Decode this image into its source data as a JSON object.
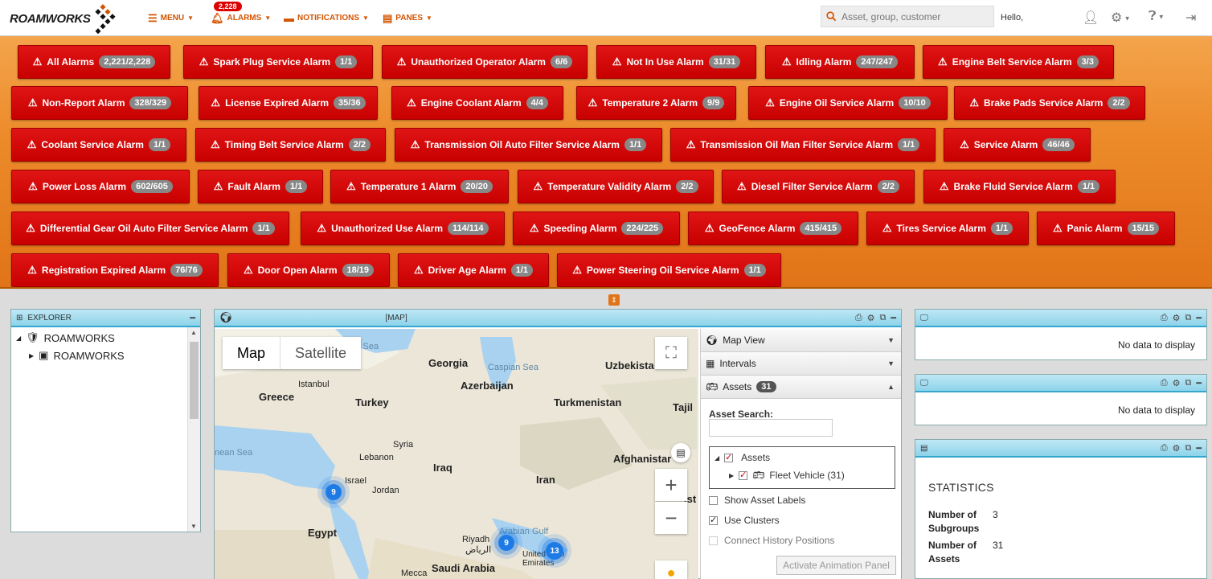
{
  "header": {
    "logo": "ROAMWORKS",
    "menu_label": "MENU",
    "alarms_label": "ALARMS",
    "alarms_count": "2,228",
    "notifications_label": "NOTIFICATIONS",
    "panes_label": "PANES",
    "search_placeholder": "Asset, group, customer",
    "hello": "Hello,"
  },
  "alarms": [
    {
      "label": "All Alarms",
      "count": "2,221/2,228"
    },
    {
      "label": "Spark Plug Service Alarm",
      "count": "1/1"
    },
    {
      "label": "Unauthorized Operator Alarm",
      "count": "6/6"
    },
    {
      "label": "Not In Use Alarm",
      "count": "31/31"
    },
    {
      "label": "Idling Alarm",
      "count": "247/247"
    },
    {
      "label": "Engine Belt Service Alarm",
      "count": "3/3"
    },
    {
      "label": "Non-Report Alarm",
      "count": "328/329"
    },
    {
      "label": "License Expired Alarm",
      "count": "35/36"
    },
    {
      "label": "Engine Coolant Alarm",
      "count": "4/4"
    },
    {
      "label": "Temperature 2 Alarm",
      "count": "9/9"
    },
    {
      "label": "Engine Oil Service Alarm",
      "count": "10/10"
    },
    {
      "label": "Brake Pads Service Alarm",
      "count": "2/2"
    },
    {
      "label": "Coolant Service Alarm",
      "count": "1/1"
    },
    {
      "label": "Timing Belt Service Alarm",
      "count": "2/2"
    },
    {
      "label": "Transmission Oil Auto Filter Service Alarm",
      "count": "1/1"
    },
    {
      "label": "Transmission Oil Man Filter Service Alarm",
      "count": "1/1"
    },
    {
      "label": "Service Alarm",
      "count": "46/46"
    },
    {
      "label": "Power Loss Alarm",
      "count": "602/605"
    },
    {
      "label": "Fault Alarm",
      "count": "1/1"
    },
    {
      "label": "Temperature 1 Alarm",
      "count": "20/20"
    },
    {
      "label": "Temperature Validity Alarm",
      "count": "2/2"
    },
    {
      "label": "Diesel Filter Service Alarm",
      "count": "2/2"
    },
    {
      "label": "Brake Fluid Service Alarm",
      "count": "1/1"
    },
    {
      "label": "Differential Gear Oil Auto Filter Service Alarm",
      "count": "1/1"
    },
    {
      "label": "Unauthorized Use Alarm",
      "count": "114/114"
    },
    {
      "label": "Speeding Alarm",
      "count": "224/225"
    },
    {
      "label": "GeoFence Alarm",
      "count": "415/415"
    },
    {
      "label": "Tires Service Alarm",
      "count": "1/1"
    },
    {
      "label": "Panic Alarm",
      "count": "15/15"
    },
    {
      "label": "Registration Expired Alarm",
      "count": "76/76"
    },
    {
      "label": "Door Open Alarm",
      "count": "18/19"
    },
    {
      "label": "Driver Age Alarm",
      "count": "1/1"
    },
    {
      "label": "Power Steering Oil Service Alarm",
      "count": "1/1"
    }
  ],
  "explorer": {
    "title": "EXPLORER",
    "tree": [
      {
        "label": "ROAMWORKS"
      },
      {
        "label": "ROAMWORKS"
      }
    ]
  },
  "map_panel": {
    "title": "[MAP]",
    "map_tab": "Map",
    "satellite_tab": "Satellite",
    "labels": {
      "georgia": "Georgia",
      "uzbekistan": "Uzbekista",
      "caspian": "Caspian Sea",
      "black_sea": "k Sea",
      "azerbaijan": "Azerbaijan",
      "istanbul": "Istanbul",
      "greece": "Greece",
      "turkey": "Turkey",
      "turkmenistan": "Turkmenistan",
      "tajik": "Tajil",
      "syria": "Syria",
      "lebanon": "Lebanon",
      "med_sea": "nean Sea",
      "iraq": "Iraq",
      "afghanistan": "Afghanistar",
      "israel": "Israel",
      "jordan": "Jordan",
      "iran": "Iran",
      "egypt": "Egypt",
      "riyadh": "Riyadh",
      "riyadh_ar": "الرياض",
      "gulf": "Arabian Gulf",
      "uae": "United Arab Emirates",
      "mecca": "Mecca",
      "saudi": "Saudi Arabia",
      "pakistan_frag": "ist"
    },
    "clusters": [
      {
        "count": "9"
      },
      {
        "count": "9"
      },
      {
        "count": "13"
      }
    ],
    "side": {
      "map_view": "Map View",
      "intervals": "Intervals",
      "assets": "Assets",
      "assets_count": "31",
      "asset_search_label": "Asset Search:",
      "tree_assets": "Assets",
      "tree_fleet": "Fleet Vehicle (31)",
      "show_labels": "Show Asset Labels",
      "use_clusters": "Use Clusters",
      "connect_history": "Connect History Positions",
      "animation_button": "Activate Animation Panel"
    }
  },
  "right_panels": {
    "panel1_nodata": "No data to display",
    "panel2_nodata": "No data to display",
    "stats_title": "STATISTICS",
    "subgroups_label": "Number of Subgroups",
    "subgroups_value": "3",
    "assets_label": "Number of Assets",
    "assets_value": "31"
  }
}
